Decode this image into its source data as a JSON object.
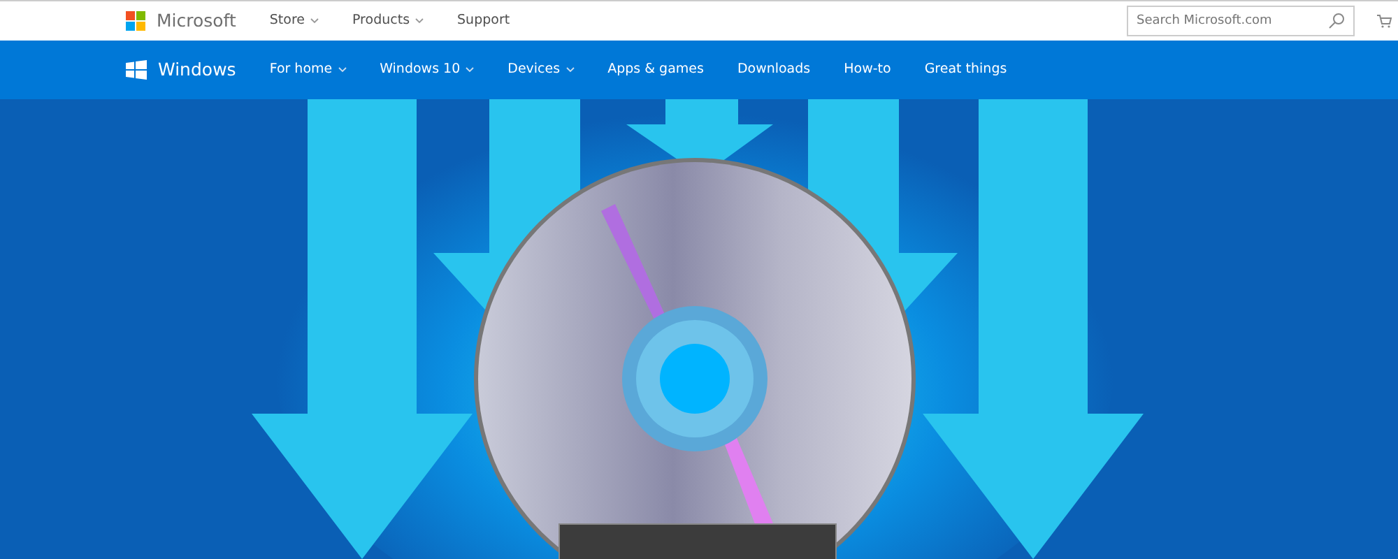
{
  "top_bar": {
    "brand": "Microsoft",
    "links": [
      {
        "label": "Store",
        "dropdown": true
      },
      {
        "label": "Products",
        "dropdown": true
      },
      {
        "label": "Support",
        "dropdown": false
      }
    ],
    "search": {
      "placeholder": "Search Microsoft.com"
    }
  },
  "nav_bar": {
    "brand": "Windows",
    "links": [
      {
        "label": "For home",
        "dropdown": true
      },
      {
        "label": "Windows 10",
        "dropdown": true
      },
      {
        "label": "Devices",
        "dropdown": true
      },
      {
        "label": "Apps & games",
        "dropdown": false
      },
      {
        "label": "Downloads",
        "dropdown": false
      },
      {
        "label": "How-to",
        "dropdown": false
      },
      {
        "label": "Great things",
        "dropdown": false
      }
    ]
  }
}
